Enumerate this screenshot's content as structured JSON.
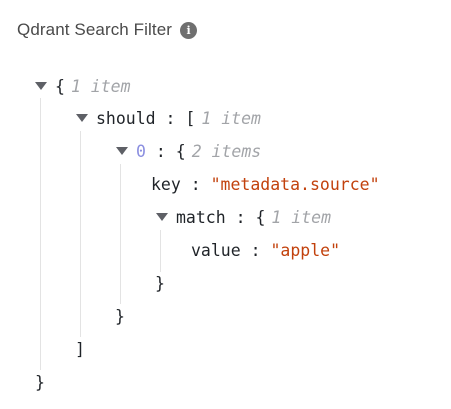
{
  "header": {
    "title": "Qdrant Search Filter",
    "info_icon": "info-icon"
  },
  "json_tree": {
    "root_open": "{",
    "root_count": "1 item",
    "should_key": "should",
    "colon": ":",
    "should_open": "[",
    "should_count": "1 item",
    "item0_index": "0",
    "item0_open": "{",
    "item0_count": "2 items",
    "key_key": "key",
    "key_value": "\"metadata.source\"",
    "match_key": "match",
    "match_open": "{",
    "match_count": "1 item",
    "value_key": "value",
    "value_value": "\"apple\"",
    "match_close": "}",
    "item0_close": "}",
    "should_close": "]",
    "root_close": "}"
  },
  "colors": {
    "string": "#c2410c",
    "index": "#8b8fe0",
    "meta": "#a2a4a8",
    "guide": "#e3e3e3"
  }
}
